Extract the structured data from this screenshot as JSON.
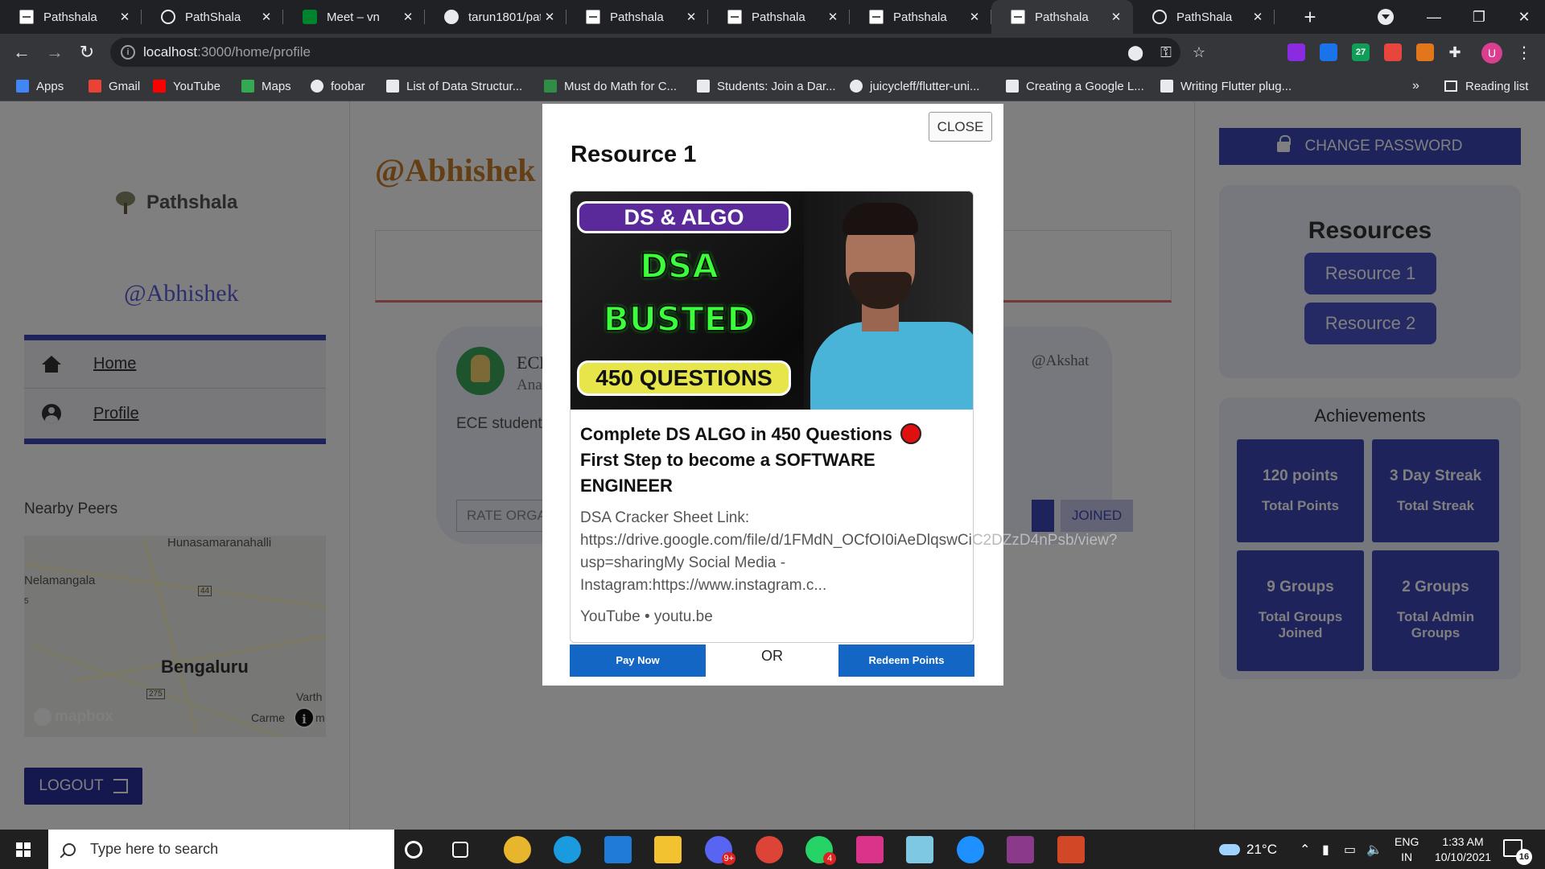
{
  "browser": {
    "tabs": [
      {
        "title": "Pathshala",
        "favicon": "doc-icon"
      },
      {
        "title": "PathShala",
        "favicon": "globe-icon"
      },
      {
        "title": "Meet – vn",
        "favicon": "meet-icon"
      },
      {
        "title": "tarun1801/pat",
        "favicon": "github-icon"
      },
      {
        "title": "Pathshala",
        "favicon": "doc-icon"
      },
      {
        "title": "Pathshala",
        "favicon": "doc-icon"
      },
      {
        "title": "Pathshala",
        "favicon": "doc-icon"
      },
      {
        "title": "Pathshala",
        "favicon": "doc-icon",
        "active": true
      },
      {
        "title": "PathShala",
        "favicon": "globe-icon"
      }
    ],
    "close_glyph": "✕",
    "new_tab_glyph": "+",
    "url_host": "localhost",
    "url_path": ":3000/home/profile",
    "bookmarks": [
      {
        "label": "Apps",
        "icon": "apps-grid-icon"
      },
      {
        "label": "Gmail",
        "icon": "gmail-icon"
      },
      {
        "label": "YouTube",
        "icon": "youtube-icon"
      },
      {
        "label": "Maps",
        "icon": "maps-pin-icon"
      },
      {
        "label": "foobar",
        "icon": "globe-icon"
      },
      {
        "label": "List of Data Structur...",
        "icon": "medium-icon"
      },
      {
        "label": "Must do Math for C...",
        "icon": "gfg-icon"
      },
      {
        "label": "Students: Join a Dar...",
        "icon": "medium-dots-icon"
      },
      {
        "label": "juicycleff/flutter-uni...",
        "icon": "github-icon"
      },
      {
        "label": "Creating a Google L...",
        "icon": "medium-dots-icon"
      },
      {
        "label": "Writing Flutter plug...",
        "icon": "medium-dots-icon"
      }
    ],
    "bookmarks_more": "»",
    "reading_list": "Reading list",
    "profile_initial": "U",
    "extensions": [
      {
        "label": "",
        "color": "#8a2be2"
      },
      {
        "label": "",
        "color": "#1a73e8"
      },
      {
        "label": "27",
        "color": "#0f9d58"
      },
      {
        "label": "",
        "color": "#e8453c"
      },
      {
        "label": "",
        "color": "#e2761b"
      }
    ]
  },
  "sidebar": {
    "brand": "Pathshala",
    "handle": "@Abhishek",
    "nav": [
      {
        "label": "Home",
        "icon": "home-icon"
      },
      {
        "label": "Profile",
        "icon": "account-circle-icon"
      }
    ],
    "nearby_title": "Nearby Peers",
    "map": {
      "labels": [
        "Hunasamaranahalli",
        "Nelamangala",
        "44",
        "Bengaluru",
        "275",
        "Varth",
        "Carme",
        "m",
        "5"
      ],
      "attribution": "mapbox"
    },
    "logout_label": "LOGOUT"
  },
  "main": {
    "handle": "@Abhishek",
    "org_name": "ECE",
    "org_sub": "Ana",
    "org_desc": "ECE students",
    "org_author": "@Akshat",
    "rate_label": "RATE ORGA",
    "joined_label": "JOINED"
  },
  "right": {
    "change_password": "CHANGE PASSWORD",
    "resources_title": "Resources",
    "resources": [
      "Resource 1",
      "Resource 2"
    ],
    "achievements_title": "Achievements",
    "achievements": [
      {
        "value": "120 points",
        "label": "Total Points"
      },
      {
        "value": "3 Day Streak",
        "label": "Total Streak"
      },
      {
        "value": "9 Groups",
        "label": "Total Groups Joined"
      },
      {
        "value": "2 Groups",
        "label": "Total Admin Groups"
      }
    ]
  },
  "modal": {
    "close_label": "CLOSE",
    "title": "Resource 1",
    "thumbnail": {
      "badge": "DS & ALGO",
      "line1": "DSA",
      "line2": "BUSTED",
      "questions": "450 QUESTIONS"
    },
    "headline": "Complete DS ALGO in 450 Questions",
    "headline2": "First Step to become a SOFTWARE ENGINEER",
    "body_lines": [
      "DSA Cracker Sheet Link:",
      "https://drive.google.com/file/d/1FMdN_OCfOI0iAeDlqswCi",
      "C2DZzD4nPsb/view?",
      "usp=sharingMy Social Media -",
      "Instagram:https://www.instagram.c..."
    ],
    "site": "YouTube • youtu.be",
    "pay_now": "Pay Now",
    "or": "OR",
    "redeem": "Redeem Points"
  },
  "taskbar": {
    "search_placeholder": "Type here to search",
    "apps": [
      {
        "icon": "cortana-icon"
      },
      {
        "icon": "task-view-icon"
      },
      {
        "icon": "chrome-icon"
      },
      {
        "icon": "edge-icon"
      },
      {
        "icon": "vscode-icon"
      },
      {
        "icon": "file-explorer-icon"
      },
      {
        "icon": "discord-icon",
        "badge": "9+"
      },
      {
        "icon": "chrome-profile-icon"
      },
      {
        "icon": "whatsapp-icon",
        "badge": "4"
      },
      {
        "icon": "terminal-icon"
      },
      {
        "icon": "notepad-icon"
      },
      {
        "icon": "bing-icon"
      },
      {
        "icon": "winrar-icon"
      },
      {
        "icon": "powerpoint-icon"
      }
    ],
    "weather": "21°C",
    "lang_top": "ENG",
    "lang_bottom": "IN",
    "time": "1:33 AM",
    "date": "10/10/2021",
    "notifications": "16"
  }
}
